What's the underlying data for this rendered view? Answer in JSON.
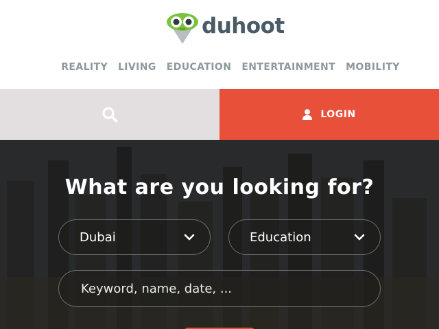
{
  "brand": {
    "name": "duhoot",
    "logo_icon": "owl-pin-logo",
    "text_color": "#4a5a66",
    "accent_green": "#7cc242"
  },
  "nav": {
    "items": [
      {
        "label": "REALITY"
      },
      {
        "label": "LIVING"
      },
      {
        "label": "EDUCATION"
      },
      {
        "label": "ENTERTAINMENT"
      },
      {
        "label": "MOBILITY"
      }
    ]
  },
  "action_bar": {
    "search_icon": "search-icon",
    "login_icon": "user-icon",
    "login_label": "LOGIN",
    "search_bg": "#e3dfe0",
    "login_bg": "#e8503a"
  },
  "hero": {
    "title": "What are you looking for?",
    "city_select": {
      "value": "Dubai"
    },
    "category_select": {
      "value": "Education"
    },
    "keyword_input": {
      "placeholder": "Keyword, name, date, ...",
      "value": ""
    }
  }
}
